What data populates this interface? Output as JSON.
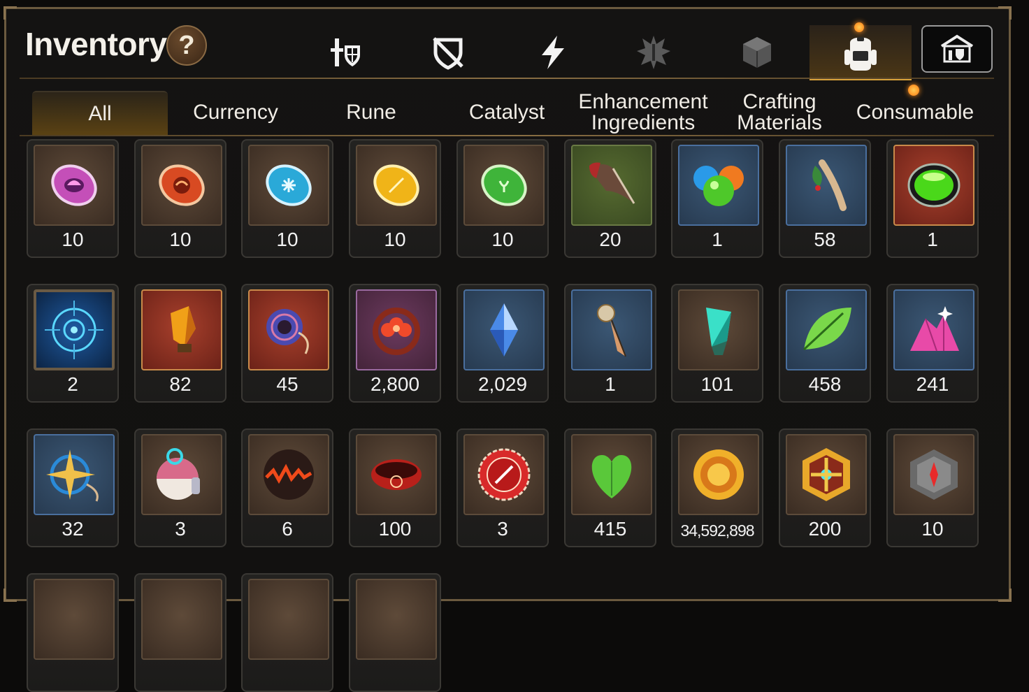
{
  "header": {
    "title": "Inventory",
    "help_label": "?"
  },
  "categories": [
    {
      "name": "equipment",
      "icon": "knight-shield-icon",
      "active": false
    },
    {
      "name": "accessory",
      "icon": "broken-shield-icon",
      "active": false
    },
    {
      "name": "skill",
      "icon": "lightning-icon",
      "active": false
    },
    {
      "name": "costume",
      "icon": "spiky-emblem-icon",
      "active": false
    },
    {
      "name": "box",
      "icon": "cube-icon",
      "active": false
    },
    {
      "name": "inventory",
      "icon": "backpack-icon",
      "active": true
    },
    {
      "name": "guild",
      "icon": "guild-hall-icon",
      "active": false
    }
  ],
  "tabs": [
    {
      "label": "All",
      "active": true
    },
    {
      "label": "Currency",
      "active": false
    },
    {
      "label": "Rune",
      "active": false
    },
    {
      "label": "Catalyst",
      "active": false
    },
    {
      "label": "Enhancement Ingredients",
      "line1": "Enhancement",
      "line2": "Ingredients",
      "active": false
    },
    {
      "label": "Crafting Materials",
      "line1": "Crafting",
      "line2": "Materials",
      "active": false
    },
    {
      "label": "Consumable",
      "active": false
    }
  ],
  "items": [
    {
      "icon": "pink-rune-icon",
      "qty": "10"
    },
    {
      "icon": "red-rune-icon",
      "qty": "10"
    },
    {
      "icon": "cyan-rune-icon",
      "qty": "10"
    },
    {
      "icon": "yellow-rune-icon",
      "qty": "10"
    },
    {
      "icon": "green-rune-icon",
      "qty": "10"
    },
    {
      "icon": "claw-icon",
      "qty": "20"
    },
    {
      "icon": "slime-orbs-icon",
      "qty": "1"
    },
    {
      "icon": "ginseng-icon",
      "qty": "58"
    },
    {
      "icon": "green-potion-icon",
      "qty": "1"
    },
    {
      "icon": "blue-portal-icon",
      "qty": "2"
    },
    {
      "icon": "orange-crystal-icon",
      "qty": "82"
    },
    {
      "icon": "donut-charm-icon",
      "qty": "45"
    },
    {
      "icon": "flower-ring-icon",
      "qty": "2,800"
    },
    {
      "icon": "blue-gem-icon",
      "qty": "2,029"
    },
    {
      "icon": "stake-icon",
      "qty": "1"
    },
    {
      "icon": "teal-crystal-icon",
      "qty": "101"
    },
    {
      "icon": "leaf-icon",
      "qty": "458"
    },
    {
      "icon": "pink-ore-icon",
      "qty": "241"
    },
    {
      "icon": "compass-star-icon",
      "qty": "32"
    },
    {
      "icon": "capsule-icon",
      "qty": "3"
    },
    {
      "icon": "lava-orb-icon",
      "qty": "6"
    },
    {
      "icon": "red-bracelet-icon",
      "qty": "100"
    },
    {
      "icon": "red-seal-icon",
      "qty": "3"
    },
    {
      "icon": "green-heart-icon",
      "qty": "415"
    },
    {
      "icon": "sun-coin-icon",
      "qty": "34,592,898"
    },
    {
      "icon": "gold-medal-icon",
      "qty": "200"
    },
    {
      "icon": "stone-compass-icon",
      "qty": "10"
    },
    {
      "icon": "partial-item-icon",
      "qty": ""
    },
    {
      "icon": "partial-item-icon",
      "qty": ""
    },
    {
      "icon": "partial-item-icon",
      "qty": ""
    },
    {
      "icon": "partial-item-icon",
      "qty": ""
    }
  ],
  "colors": {
    "accent_gold": "#d9a23a",
    "notification": "#ff8a1a",
    "frame": "#6b5a3f"
  }
}
